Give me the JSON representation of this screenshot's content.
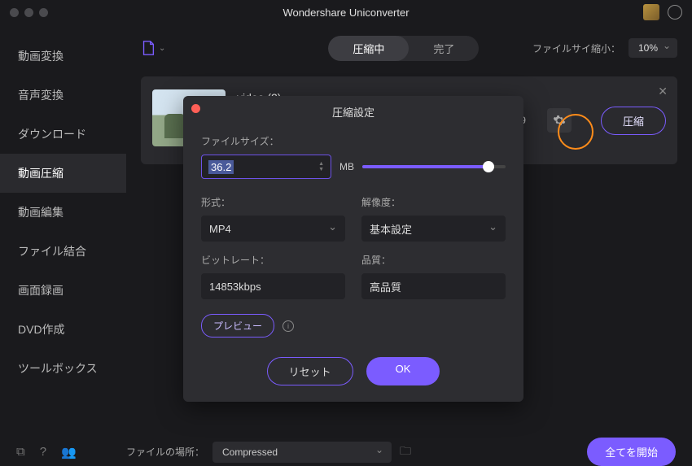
{
  "app": {
    "title": "Wondershare Uniconverter"
  },
  "sidebar": {
    "items": [
      {
        "label": "動画変換"
      },
      {
        "label": "音声変換"
      },
      {
        "label": "ダウンロード"
      },
      {
        "label": "動画圧縮"
      },
      {
        "label": "動画編集"
      },
      {
        "label": "ファイル結合"
      },
      {
        "label": "画面録画"
      },
      {
        "label": "DVD作成"
      },
      {
        "label": "ツールボックス"
      }
    ]
  },
  "toolbar": {
    "tab_compressing": "圧縮中",
    "tab_done": "完了",
    "shrink_label": "ファイルサイ縮小：",
    "shrink_value": "10%"
  },
  "card": {
    "title": "video (2)",
    "duration": "00:00:19",
    "compress_label": "圧縮"
  },
  "modal": {
    "title": "圧縮設定",
    "filesize_label": "ファイルサイズ：",
    "filesize_value": "36.2",
    "unit": "MB",
    "format_label": "形式：",
    "format_value": "MP4",
    "resolution_label": "解像度：",
    "resolution_value": "基本設定",
    "bitrate_label": "ビットレート：",
    "bitrate_value": "14853kbps",
    "quality_label": "品質：",
    "quality_value": "高品質",
    "preview": "プレビュー",
    "reset": "リセット",
    "ok": "OK"
  },
  "footer": {
    "location_label": "ファイルの場所：",
    "location_value": "Compressed",
    "start_all": "全てを開始"
  }
}
